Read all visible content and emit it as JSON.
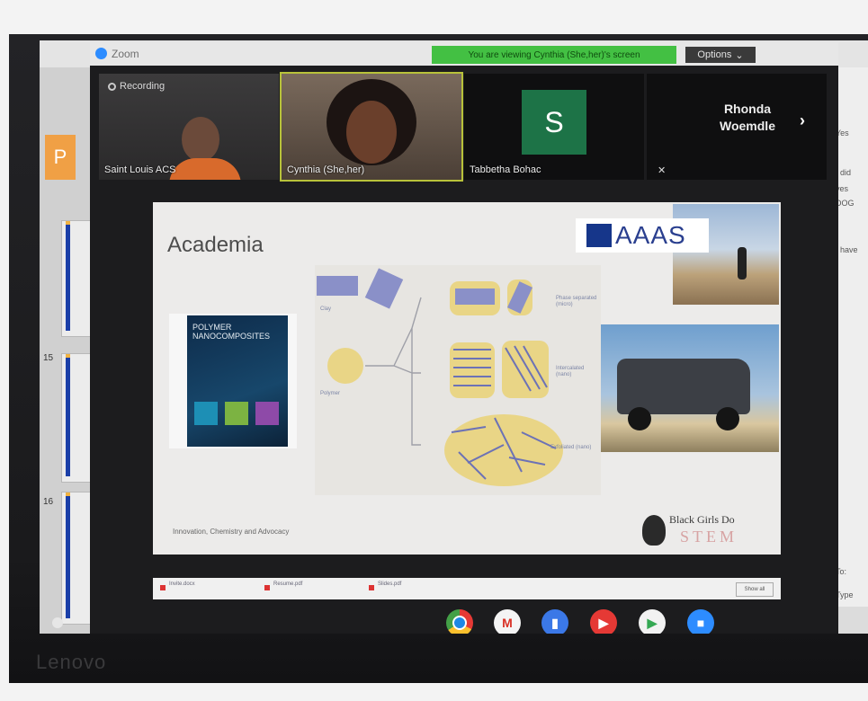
{
  "zoom": {
    "title": "Zoom",
    "share_banner": "You are viewing Cynthia (She,her)'s screen",
    "options_label": "Options",
    "options_chevron": "chevron-down-icon",
    "recording_label": "Recording"
  },
  "participants": [
    {
      "name": "Saint Louis ACS"
    },
    {
      "name": "Cynthia (She,her)"
    },
    {
      "name": "Tabbetha Bohac",
      "avatar_letter": "S"
    },
    {
      "name": "Rhonda Woemdle"
    }
  ],
  "next_icon": "chevron-right-icon",
  "slide": {
    "title": "Academia",
    "logo_text": "AAAS",
    "book_title": "POLYMER NANOCOMPOSITES",
    "diagram_labels": [
      "Phase separated (micro)",
      "Intercalated (nano)",
      "Exfoliated (nano)",
      "Clay",
      "Polymer"
    ],
    "footer": "Innovation, Chemistry and Advocacy",
    "bgds_line1": "Black Girls Do",
    "bgds_line2": "STEM"
  },
  "downloads": {
    "items": [
      "Invite.docx",
      "Resume.pdf",
      "Slides.pdf"
    ],
    "show_all": "Show all"
  },
  "slides_app": {
    "thumb_numbers": [
      "15",
      "16"
    ],
    "p_badge": "P"
  },
  "chat_lines": [
    "Yes",
    "I did",
    "yes",
    "DOG",
    "I have"
  ],
  "chat_bottom": [
    "To:",
    "Type"
  ],
  "laptop_brand": "Lenovo",
  "shelf_apps": [
    {
      "name": "chrome-icon",
      "color": "#d33c2c"
    },
    {
      "name": "gmail-icon",
      "color": "#e8e8e8"
    },
    {
      "name": "docs-icon",
      "color": "#3b78e7"
    },
    {
      "name": "youtube-icon",
      "color": "#e53935"
    },
    {
      "name": "play-store-icon",
      "color": "#f2f2f2"
    },
    {
      "name": "zoom-icon",
      "color": "#2d8cff"
    }
  ],
  "mute_icon": "mic-muted-icon"
}
